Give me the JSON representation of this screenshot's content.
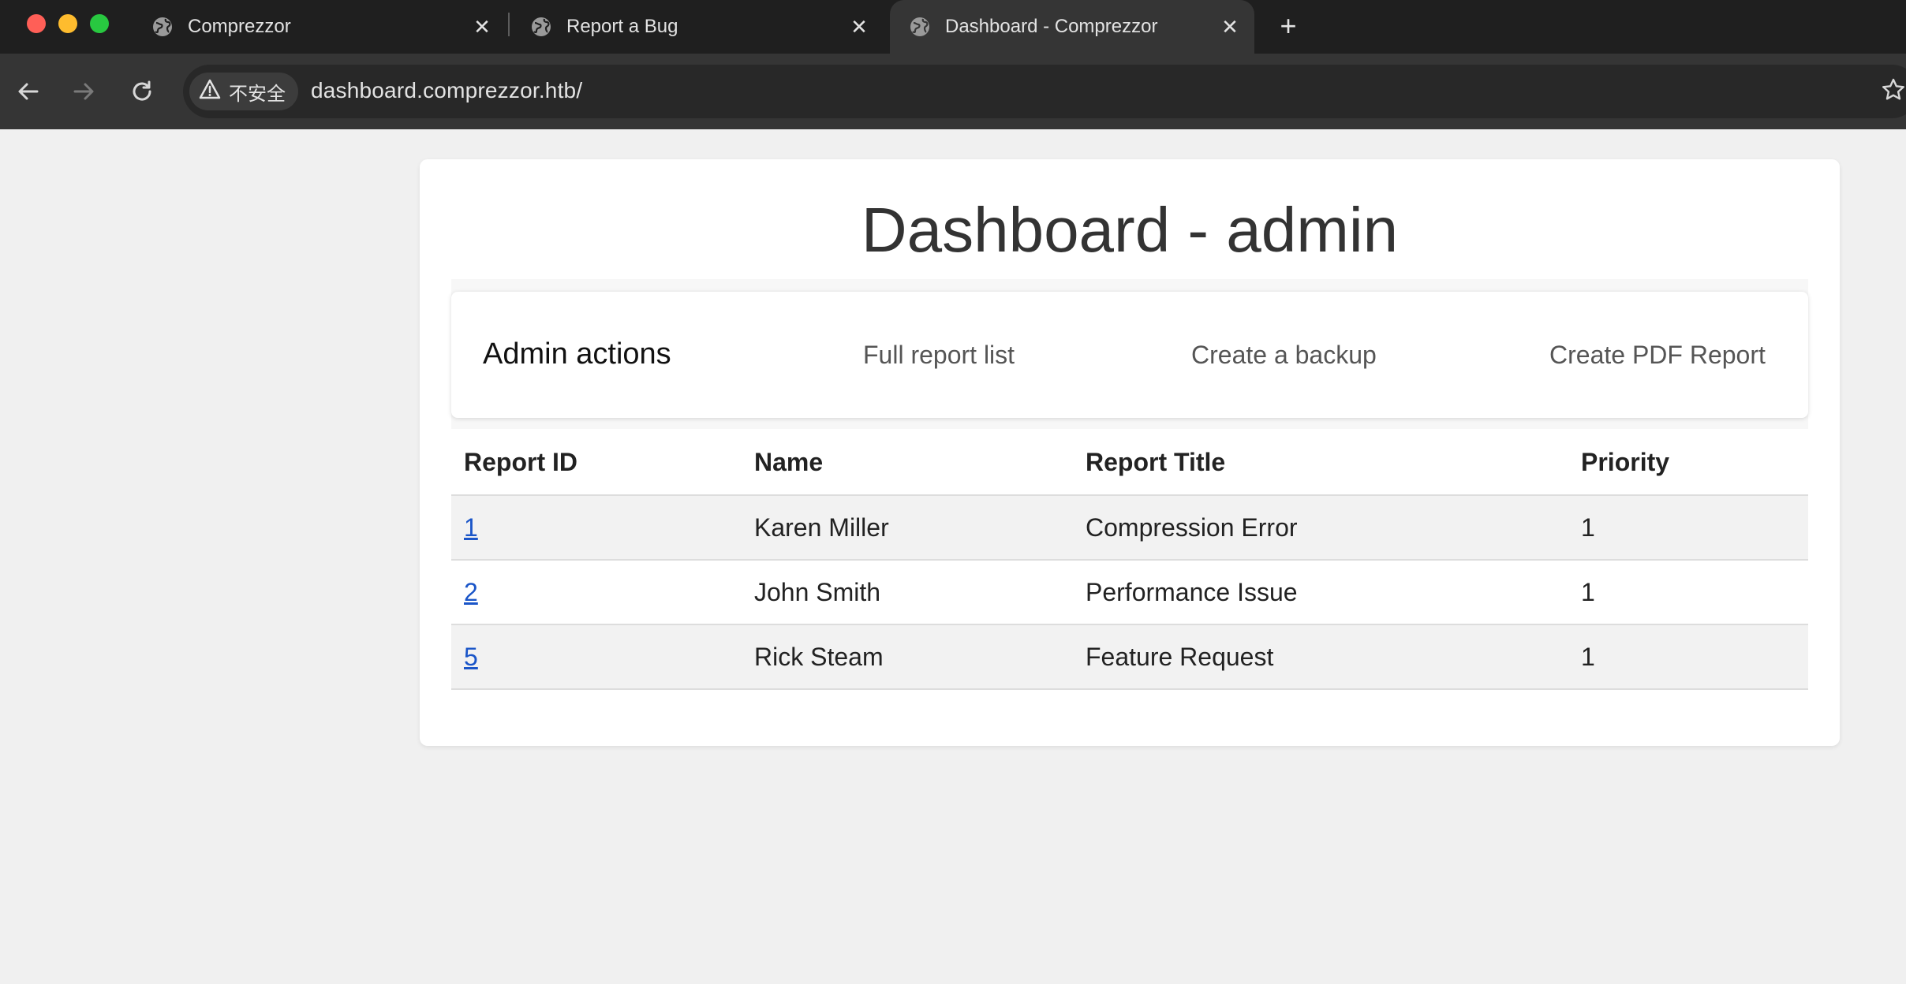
{
  "browser": {
    "tabs": [
      {
        "title": "Comprezzor",
        "active": false
      },
      {
        "title": "Report a Bug",
        "active": false
      },
      {
        "title": "Dashboard - Comprezzor",
        "active": true
      }
    ],
    "security_label": "不安全",
    "url": "dashboard.comprezzor.htb/"
  },
  "page": {
    "title": "Dashboard - admin",
    "nav": {
      "brand": "Admin actions",
      "links": [
        "Full report list",
        "Create a backup",
        "Create PDF Report"
      ]
    },
    "table": {
      "headers": [
        "Report ID",
        "Name",
        "Report Title",
        "Priority"
      ],
      "rows": [
        {
          "id": "1",
          "name": "Karen Miller",
          "title": "Compression Error",
          "priority": "1"
        },
        {
          "id": "2",
          "name": "John Smith",
          "title": "Performance Issue",
          "priority": "1"
        },
        {
          "id": "5",
          "name": "Rick Steam",
          "title": "Feature Request",
          "priority": "1"
        }
      ]
    }
  }
}
